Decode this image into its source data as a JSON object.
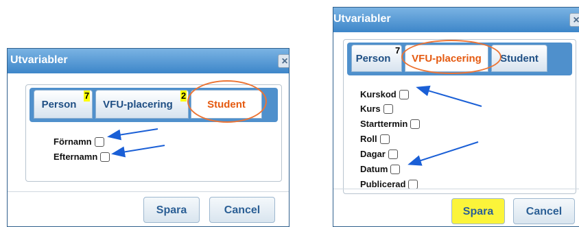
{
  "colors": {
    "titlebar": "#4f90cc",
    "tab_text": "#1f4f84",
    "active_tab_text": "#e55a10",
    "annotation_oval": "#ec7434",
    "annotation_arrow": "#1a5fd6",
    "badge_highlight": "#ffff00",
    "spara_highlight": "#fbf43a"
  },
  "left_dialog": {
    "title": "Utvariabler",
    "close_icon": "close-icon",
    "tabs": [
      {
        "label": "Person",
        "badge": "7"
      },
      {
        "label": "VFU-placering",
        "badge": "2"
      },
      {
        "label": "Student",
        "badge": ""
      }
    ],
    "active_tab": "Student",
    "fields": [
      "Förnamn",
      "Efternamn"
    ],
    "buttons": {
      "save": "Spara",
      "cancel": "Cancel"
    }
  },
  "right_dialog": {
    "title": "Utvariabler",
    "close_icon": "close-icon",
    "tabs": [
      {
        "label": "Person",
        "badge": "7"
      },
      {
        "label": "VFU-placering",
        "badge": ""
      },
      {
        "label": "Student",
        "badge": ""
      }
    ],
    "active_tab": "VFU-placering",
    "fields": [
      "Kurskod",
      "Kurs",
      "Starttermin",
      "Roll",
      "Dagar",
      "Datum",
      "Publicerad"
    ],
    "buttons": {
      "save": "Spara",
      "cancel": "Cancel"
    }
  }
}
